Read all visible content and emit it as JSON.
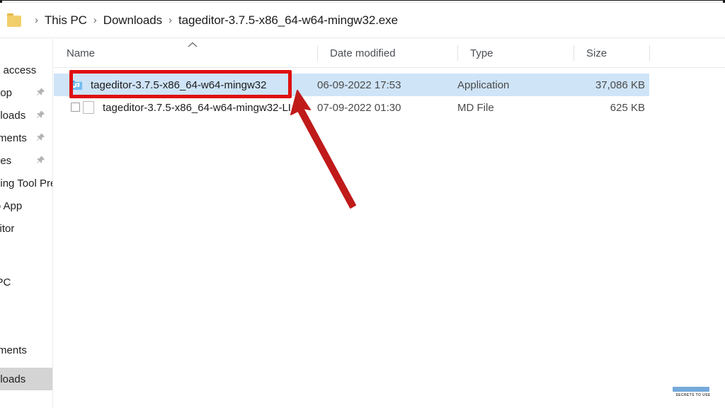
{
  "window": {
    "breadcrumb": {
      "folder_icon": "folder-icon",
      "separator": "›",
      "items": [
        "This PC",
        "Downloads",
        "tageditor-3.7.5-x86_64-w64-mingw32.exe"
      ]
    }
  },
  "sidebar": {
    "items": [
      {
        "label": "Quick access",
        "pin": false,
        "selected": false
      },
      {
        "label": "Desktop",
        "pin": true,
        "selected": false
      },
      {
        "label": "Downloads",
        "pin": true,
        "selected": false
      },
      {
        "label": "Documents",
        "pin": true,
        "selected": false
      },
      {
        "label": "Pictures",
        "pin": true,
        "selected": false
      },
      {
        "label": "Snipping Tool Preview App",
        "pin": false,
        "selected": false
      },
      {
        "label": "Photo App",
        "pin": false,
        "selected": false
      },
      {
        "label": "tageditor",
        "pin": false,
        "selected": false
      },
      {
        "label": "This PC",
        "pin": false,
        "selected": false
      },
      {
        "label": "Documents",
        "pin": false,
        "selected": false
      },
      {
        "label": "Downloads",
        "pin": false,
        "selected": true
      }
    ]
  },
  "filelist": {
    "columns": [
      {
        "label": "Name",
        "sorted": "asc"
      },
      {
        "label": "Date modified",
        "sorted": ""
      },
      {
        "label": "Type",
        "sorted": ""
      },
      {
        "label": "Size",
        "sorted": ""
      }
    ],
    "sort_icon": "chevron-up-icon",
    "rows": [
      {
        "name": "tageditor-3.7.5-x86_64-w64-mingw32",
        "date": "06-09-2022 17:53",
        "type": "Application",
        "size": "37,086 KB",
        "icon": "tageditor-app-icon",
        "selected": true
      },
      {
        "name": "tageditor-3.7.5-x86_64-w64-mingw32-LI...",
        "date": "07-09-2022 01:30",
        "type": "MD File",
        "size": "625 KB",
        "icon": "md-file-icon",
        "selected": false
      }
    ]
  },
  "annotations": {
    "highlight_box": {
      "target": "first-file-row-name",
      "color": "#e00f0f"
    },
    "arrow": {
      "points_to": "first-file-row-name",
      "color": "#c01a1a"
    }
  },
  "watermark": {
    "text": "SECRETS TO USE"
  },
  "colors": {
    "selection_blue": "#cfe4f7",
    "annotation_red": "#e00f0f",
    "sidebar_selected": "#d4d4d4",
    "folder_yellow": "#f2ce6a"
  }
}
